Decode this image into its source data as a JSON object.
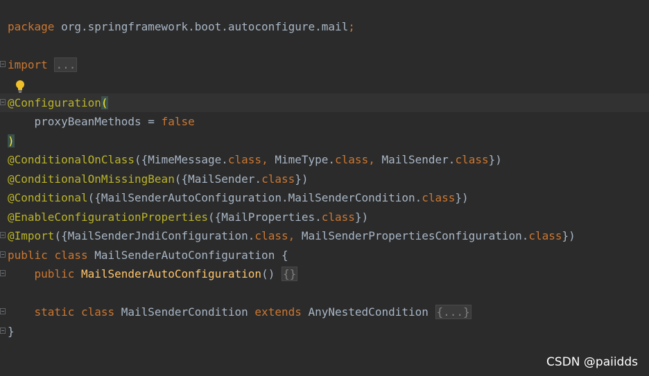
{
  "code_lines": [
    {
      "tokens": [
        {
          "t": "package ",
          "c": "kw"
        },
        {
          "t": "org.springframework.boot.autoconfigure.mail",
          "c": "plain"
        },
        {
          "t": ";",
          "c": "kw"
        }
      ]
    },
    {
      "tokens": []
    },
    {
      "tokens": [
        {
          "t": "import ",
          "c": "kw"
        },
        {
          "t": "...",
          "c": "folded"
        }
      ]
    },
    {
      "tokens": []
    },
    {
      "tokens": [
        {
          "t": "@Configuration",
          "c": "ann"
        },
        {
          "t": "(",
          "c": "paren-hl"
        }
      ]
    },
    {
      "tokens": [
        {
          "t": "    proxyBeanMethods = ",
          "c": "plain"
        },
        {
          "t": "false",
          "c": "kw"
        }
      ]
    },
    {
      "tokens": [
        {
          "t": ")",
          "c": "paren-hl"
        }
      ]
    },
    {
      "tokens": [
        {
          "t": "@ConditionalOnClass",
          "c": "ann"
        },
        {
          "t": "({MimeMessage.",
          "c": "plain"
        },
        {
          "t": "class",
          "c": "kw"
        },
        {
          "t": ", ",
          "c": "kw"
        },
        {
          "t": "MimeType.",
          "c": "plain"
        },
        {
          "t": "class",
          "c": "kw"
        },
        {
          "t": ", ",
          "c": "kw"
        },
        {
          "t": "MailSender.",
          "c": "plain"
        },
        {
          "t": "class",
          "c": "kw"
        },
        {
          "t": "})",
          "c": "plain"
        }
      ]
    },
    {
      "tokens": [
        {
          "t": "@ConditionalOnMissingBean",
          "c": "ann"
        },
        {
          "t": "({MailSender.",
          "c": "plain"
        },
        {
          "t": "class",
          "c": "kw"
        },
        {
          "t": "})",
          "c": "plain"
        }
      ]
    },
    {
      "tokens": [
        {
          "t": "@Conditional",
          "c": "ann"
        },
        {
          "t": "({MailSenderAutoConfiguration.MailSenderCondition.",
          "c": "plain"
        },
        {
          "t": "class",
          "c": "kw"
        },
        {
          "t": "})",
          "c": "plain"
        }
      ]
    },
    {
      "tokens": [
        {
          "t": "@EnableConfigurationProperties",
          "c": "ann"
        },
        {
          "t": "({MailProperties.",
          "c": "plain"
        },
        {
          "t": "class",
          "c": "kw"
        },
        {
          "t": "})",
          "c": "plain"
        }
      ]
    },
    {
      "tokens": [
        {
          "t": "@Import",
          "c": "ann"
        },
        {
          "t": "({MailSenderJndiConfiguration.",
          "c": "plain"
        },
        {
          "t": "class",
          "c": "kw"
        },
        {
          "t": ", ",
          "c": "kw"
        },
        {
          "t": "MailSenderPropertiesConfiguration.",
          "c": "plain"
        },
        {
          "t": "class",
          "c": "kw"
        },
        {
          "t": "})",
          "c": "plain"
        }
      ]
    },
    {
      "tokens": [
        {
          "t": "public ",
          "c": "kw"
        },
        {
          "t": "class ",
          "c": "kw"
        },
        {
          "t": "MailSenderAutoConfiguration {",
          "c": "plain"
        }
      ]
    },
    {
      "tokens": [
        {
          "t": "    public ",
          "c": "kw"
        },
        {
          "t": "MailSenderAutoConfiguration",
          "c": "fn"
        },
        {
          "t": "() ",
          "c": "plain"
        },
        {
          "t": "{}",
          "c": "folded"
        }
      ]
    },
    {
      "tokens": []
    },
    {
      "tokens": [
        {
          "t": "    static ",
          "c": "kw"
        },
        {
          "t": "class ",
          "c": "kw"
        },
        {
          "t": "MailSenderCondition ",
          "c": "plain"
        },
        {
          "t": "extends ",
          "c": "kw"
        },
        {
          "t": "AnyNestedCondition ",
          "c": "plain"
        },
        {
          "t": "{...}",
          "c": "folded"
        }
      ]
    },
    {
      "tokens": [
        {
          "t": "}",
          "c": "plain"
        }
      ]
    }
  ],
  "watermark": "CSDN @paiidds",
  "icons": {
    "intention": "lightbulb-icon",
    "fold": "fold-marker-icon"
  },
  "colors": {
    "background": "#2b2b2b",
    "keyword": "#cc7832",
    "annotation": "#bbb529",
    "method": "#ffc66d",
    "text": "#a9b7c6"
  }
}
